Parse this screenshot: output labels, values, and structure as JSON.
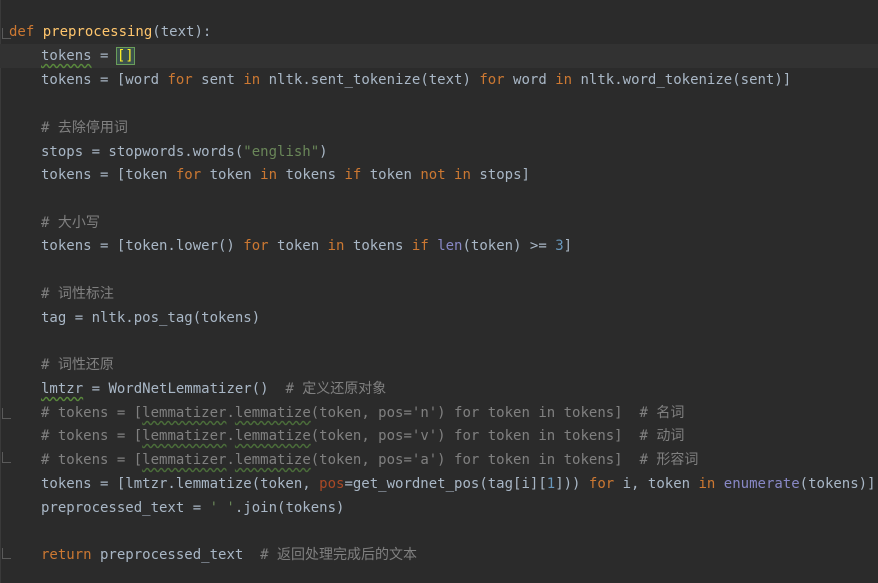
{
  "editor": {
    "lines": [
      {
        "id": "l1",
        "segments": [
          [
            "kw",
            "def "
          ],
          [
            "fn",
            "preprocessing"
          ],
          [
            "plain",
            "(text):"
          ]
        ]
      },
      {
        "id": "l2",
        "segments": [
          [
            "ind",
            ""
          ],
          [
            "squig",
            "tokens"
          ],
          [
            "plain",
            " = "
          ],
          [
            "bracket",
            "[]"
          ]
        ]
      },
      {
        "id": "l3",
        "segments": [
          [
            "ind",
            ""
          ],
          [
            "plain",
            "tokens = [word "
          ],
          [
            "kw",
            "for"
          ],
          [
            "plain",
            " sent "
          ],
          [
            "kw",
            "in"
          ],
          [
            "plain",
            " nltk.sent_tokenize(text) "
          ],
          [
            "kw",
            "for"
          ],
          [
            "plain",
            " word "
          ],
          [
            "kw",
            "in"
          ],
          [
            "plain",
            " nltk.word_tokenize(sent)]"
          ]
        ]
      },
      {
        "id": "l4",
        "segments": []
      },
      {
        "id": "l5",
        "segments": [
          [
            "ind",
            ""
          ],
          [
            "cmt",
            "# 去除停用词"
          ]
        ]
      },
      {
        "id": "l6",
        "segments": [
          [
            "ind",
            ""
          ],
          [
            "plain",
            "stops = stopwords.words("
          ],
          [
            "str",
            "\"english\""
          ],
          [
            "plain",
            ")"
          ]
        ]
      },
      {
        "id": "l7",
        "segments": [
          [
            "ind",
            ""
          ],
          [
            "plain",
            "tokens = [token "
          ],
          [
            "kw",
            "for"
          ],
          [
            "plain",
            " token "
          ],
          [
            "kw",
            "in"
          ],
          [
            "plain",
            " tokens "
          ],
          [
            "kw",
            "if"
          ],
          [
            "plain",
            " token "
          ],
          [
            "kw",
            "not in"
          ],
          [
            "plain",
            " stops]"
          ]
        ]
      },
      {
        "id": "l8",
        "segments": []
      },
      {
        "id": "l9",
        "segments": [
          [
            "ind",
            ""
          ],
          [
            "cmt",
            "# 大小写"
          ]
        ]
      },
      {
        "id": "l10",
        "segments": [
          [
            "ind",
            ""
          ],
          [
            "plain",
            "tokens = [token.lower() "
          ],
          [
            "kw",
            "for"
          ],
          [
            "plain",
            " token "
          ],
          [
            "kw",
            "in"
          ],
          [
            "plain",
            " tokens "
          ],
          [
            "kw",
            "if"
          ],
          [
            "plain",
            " "
          ],
          [
            "builtin",
            "len"
          ],
          [
            "plain",
            "(token) >= "
          ],
          [
            "num",
            "3"
          ],
          [
            "plain",
            "]"
          ]
        ]
      },
      {
        "id": "l11",
        "segments": []
      },
      {
        "id": "l12",
        "segments": [
          [
            "ind",
            ""
          ],
          [
            "cmt",
            "# 词性标注"
          ]
        ]
      },
      {
        "id": "l13",
        "segments": [
          [
            "ind",
            ""
          ],
          [
            "plain",
            "tag = nltk.pos_tag(tokens)"
          ]
        ]
      },
      {
        "id": "l14",
        "segments": []
      },
      {
        "id": "l15",
        "segments": [
          [
            "ind",
            ""
          ],
          [
            "cmt",
            "# 词性还原"
          ]
        ]
      },
      {
        "id": "l16",
        "segments": [
          [
            "ind",
            ""
          ],
          [
            "squig",
            "lmtzr"
          ],
          [
            "plain",
            " = WordNetLemmatizer()  "
          ],
          [
            "cmt",
            "# 定义还原对象"
          ]
        ]
      },
      {
        "id": "l17",
        "segments": [
          [
            "ind",
            ""
          ],
          [
            "cmt",
            "# tokens = ["
          ],
          [
            "cmtsq",
            "lemmatizer"
          ],
          [
            "cmt",
            "."
          ],
          [
            "cmtsq",
            "lemmatize"
          ],
          [
            "cmt",
            "(token, pos='n') for token in tokens]  # 名词"
          ]
        ]
      },
      {
        "id": "l18",
        "segments": [
          [
            "ind",
            ""
          ],
          [
            "cmt",
            "# tokens = ["
          ],
          [
            "cmtsq",
            "lemmatizer"
          ],
          [
            "cmt",
            "."
          ],
          [
            "cmtsq",
            "lemmatize"
          ],
          [
            "cmt",
            "(token, pos='v') for token in tokens]  # 动词"
          ]
        ]
      },
      {
        "id": "l19",
        "segments": [
          [
            "ind",
            ""
          ],
          [
            "cmt",
            "# tokens = ["
          ],
          [
            "cmtsq",
            "lemmatizer"
          ],
          [
            "cmt",
            "."
          ],
          [
            "cmtsq",
            "lemmatize"
          ],
          [
            "cmt",
            "(token, pos='a') for token in tokens]  # 形容词"
          ]
        ]
      },
      {
        "id": "l20",
        "segments": [
          [
            "ind",
            ""
          ],
          [
            "plain",
            "tokens = [lmtzr.lemmatize(token, "
          ],
          [
            "kwarg",
            "pos"
          ],
          [
            "plain",
            "=get_wordnet_pos(tag[i]["
          ],
          [
            "num",
            "1"
          ],
          [
            "plain",
            "])) "
          ],
          [
            "kw",
            "for"
          ],
          [
            "plain",
            " i, token "
          ],
          [
            "kw",
            "in"
          ],
          [
            "plain",
            " "
          ],
          [
            "builtin",
            "enumerate"
          ],
          [
            "plain",
            "(tokens)]"
          ]
        ]
      },
      {
        "id": "l21",
        "segments": [
          [
            "ind",
            ""
          ],
          [
            "plain",
            "preprocessed_text = "
          ],
          [
            "str",
            "' '"
          ],
          [
            "plain",
            ".join(tokens)"
          ]
        ]
      },
      {
        "id": "l22",
        "segments": []
      },
      {
        "id": "l23",
        "segments": [
          [
            "ind",
            ""
          ],
          [
            "kw",
            "return"
          ],
          [
            "plain",
            " preprocessed_text  "
          ],
          [
            "cmt",
            "# 返回处理完成后的文本"
          ]
        ]
      }
    ]
  }
}
